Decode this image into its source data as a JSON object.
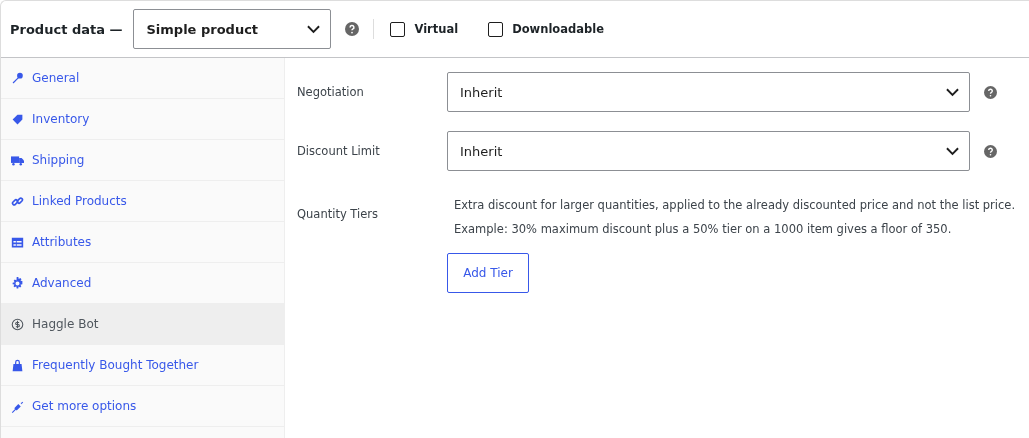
{
  "header": {
    "title": "Product data —",
    "product_type": "Simple product",
    "checkboxes": [
      {
        "label": "Virtual",
        "checked": false
      },
      {
        "label": "Downloadable",
        "checked": false
      }
    ]
  },
  "tabs": [
    {
      "label": "General",
      "kind": "wrench",
      "selected": false
    },
    {
      "label": "Inventory",
      "kind": "tag",
      "selected": false
    },
    {
      "label": "Shipping",
      "kind": "truck",
      "selected": false
    },
    {
      "label": "Linked Products",
      "kind": "link",
      "selected": false
    },
    {
      "label": "Attributes",
      "kind": "list",
      "selected": false
    },
    {
      "label": "Advanced",
      "kind": "gear",
      "selected": false
    },
    {
      "label": "Haggle Bot",
      "kind": "dollar",
      "selected": true
    },
    {
      "label": "Frequently Bought Together",
      "kind": "bag",
      "selected": false
    },
    {
      "label": "Get more options",
      "kind": "plug",
      "selected": false
    }
  ],
  "fields": [
    {
      "kind": "select",
      "label": "Negotiation",
      "value": "Inherit"
    },
    {
      "kind": "select",
      "label": "Discount Limit",
      "value": "Inherit"
    },
    {
      "kind": "tiers",
      "label": "Quantity Tiers",
      "lines": [
        "Extra discount for larger quantities, applied to the already discounted price and not the list price.",
        "Example: 30% maximum discount plus a 50% tier on a 1000 item gives a floor of 350."
      ],
      "button": "Add Tier"
    }
  ]
}
